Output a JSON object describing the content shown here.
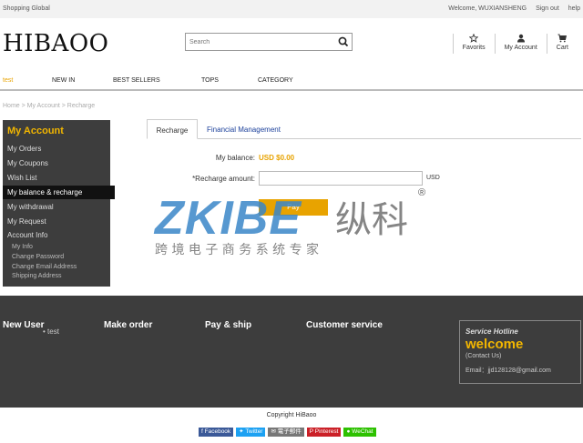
{
  "topbar": {
    "left": "Shopping Global",
    "welcome": "Welcome, WUXIANSHENG",
    "signout": "Sign out",
    "help": "help"
  },
  "header": {
    "logo": "HIBAOO",
    "search_placeholder": "Search",
    "icons": [
      {
        "label": "Favorits",
        "icon": "star-icon"
      },
      {
        "label": "My Account",
        "icon": "user-icon"
      },
      {
        "label": "Cart",
        "icon": "cart-icon"
      }
    ]
  },
  "nav": {
    "items": [
      "test",
      "NEW IN",
      "BEST SELLERS",
      "TOPS",
      "CATEGORY"
    ],
    "active_color": "#e8a300"
  },
  "breadcrumb": "Home > My Account > Recharge",
  "sidebar": {
    "title": "My Account",
    "items": [
      "My Orders",
      "My Coupons",
      "Wish List",
      "My balance & recharge",
      "My withdrawal",
      "My Request",
      "Account Info"
    ],
    "active": "My balance & recharge",
    "sub_items": [
      "My Info",
      "Change Password",
      "Change Email Address",
      "Shipping Address"
    ]
  },
  "tabs": [
    "Recharge",
    "Financial Management"
  ],
  "form": {
    "balance_label": "My balance:",
    "balance_value": "USD $0.00",
    "amount_label": "*Recharge amount:",
    "amount_value": "",
    "currency": "USD",
    "pay_label": "Pay"
  },
  "watermark": {
    "logo": "ZKIBE",
    "cn_name": "纵科",
    "cn_tagline": "跨 境 电 子 商 务 系 统 专 家",
    "reg": "®"
  },
  "footer": {
    "columns": [
      "New User",
      "Make order",
      "Pay & ship",
      "Customer service"
    ],
    "new_user_link": "• test",
    "hotline_title": "Service Hotline",
    "hotline_welcome": "welcome",
    "contact": "(Contact Us)",
    "email": "Email：jjd128128@gmail.com",
    "copyright": "Copyright HiBaoo"
  },
  "social": [
    {
      "label": "Facebook",
      "color": "#3b5998",
      "icon": "facebook-icon"
    },
    {
      "label": "Twitter",
      "color": "#1da1f2",
      "icon": "twitter-icon"
    },
    {
      "label": "電子郵件",
      "color": "#777777",
      "icon": "email-icon"
    },
    {
      "label": "Pinterest",
      "color": "#cb2027",
      "icon": "pinterest-icon"
    },
    {
      "label": "WeChat",
      "color": "#2dc100",
      "icon": "wechat-icon"
    }
  ],
  "colors": {
    "accent": "#e8a300",
    "sidebar_bg": "#3d3d3d",
    "link_blue": "#1a3f9a",
    "watermark_blue": "#3a86c8"
  }
}
